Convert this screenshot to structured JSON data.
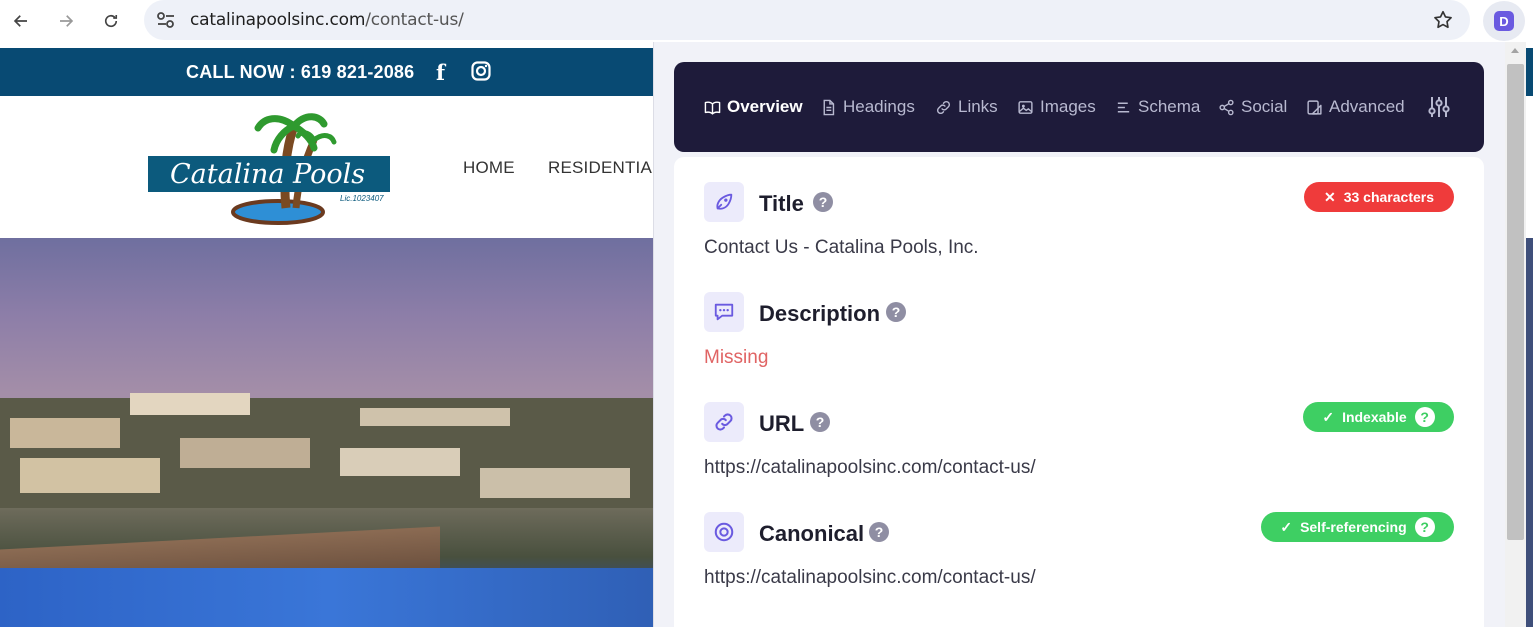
{
  "browser": {
    "url_host": "catalinapoolsinc.com",
    "url_path": "/contact-us/",
    "extension_letter": "D"
  },
  "site": {
    "call_text": "CALL NOW : 619 821-2086",
    "facebook_glyph": "f",
    "brand": "Catalina Pools",
    "license": "Lic.1023407",
    "menu": [
      "HOME",
      "RESIDENTIAL"
    ]
  },
  "panel": {
    "tabs": [
      {
        "label": "Overview",
        "icon": "book-icon"
      },
      {
        "label": "Headings",
        "icon": "document-icon"
      },
      {
        "label": "Links",
        "icon": "link-icon"
      },
      {
        "label": "Images",
        "icon": "image-icon"
      },
      {
        "label": "Schema",
        "icon": "list-icon"
      },
      {
        "label": "Social",
        "icon": "share-icon"
      },
      {
        "label": "Advanced",
        "icon": "shapes-icon"
      }
    ],
    "rows": {
      "title": {
        "label": "Title",
        "value": "Contact Us - Catalina Pools, Inc.",
        "badge": "33 characters",
        "badge_mark": "✕"
      },
      "description": {
        "label": "Description",
        "value": "Missing"
      },
      "url": {
        "label": "URL",
        "value": "https://catalinapoolsinc.com/contact-us/",
        "badge": "Indexable",
        "badge_mark": "✓"
      },
      "canonical": {
        "label": "Canonical",
        "value": "https://catalinapoolsinc.com/contact-us/",
        "badge": "Self-referencing",
        "badge_mark": "✓"
      }
    },
    "help_glyph": "?",
    "colors": {
      "accent": "#6a5ae0",
      "error": "#ef3b3b",
      "success": "#3ecf63",
      "nav_bg": "#1e1b3a"
    }
  }
}
